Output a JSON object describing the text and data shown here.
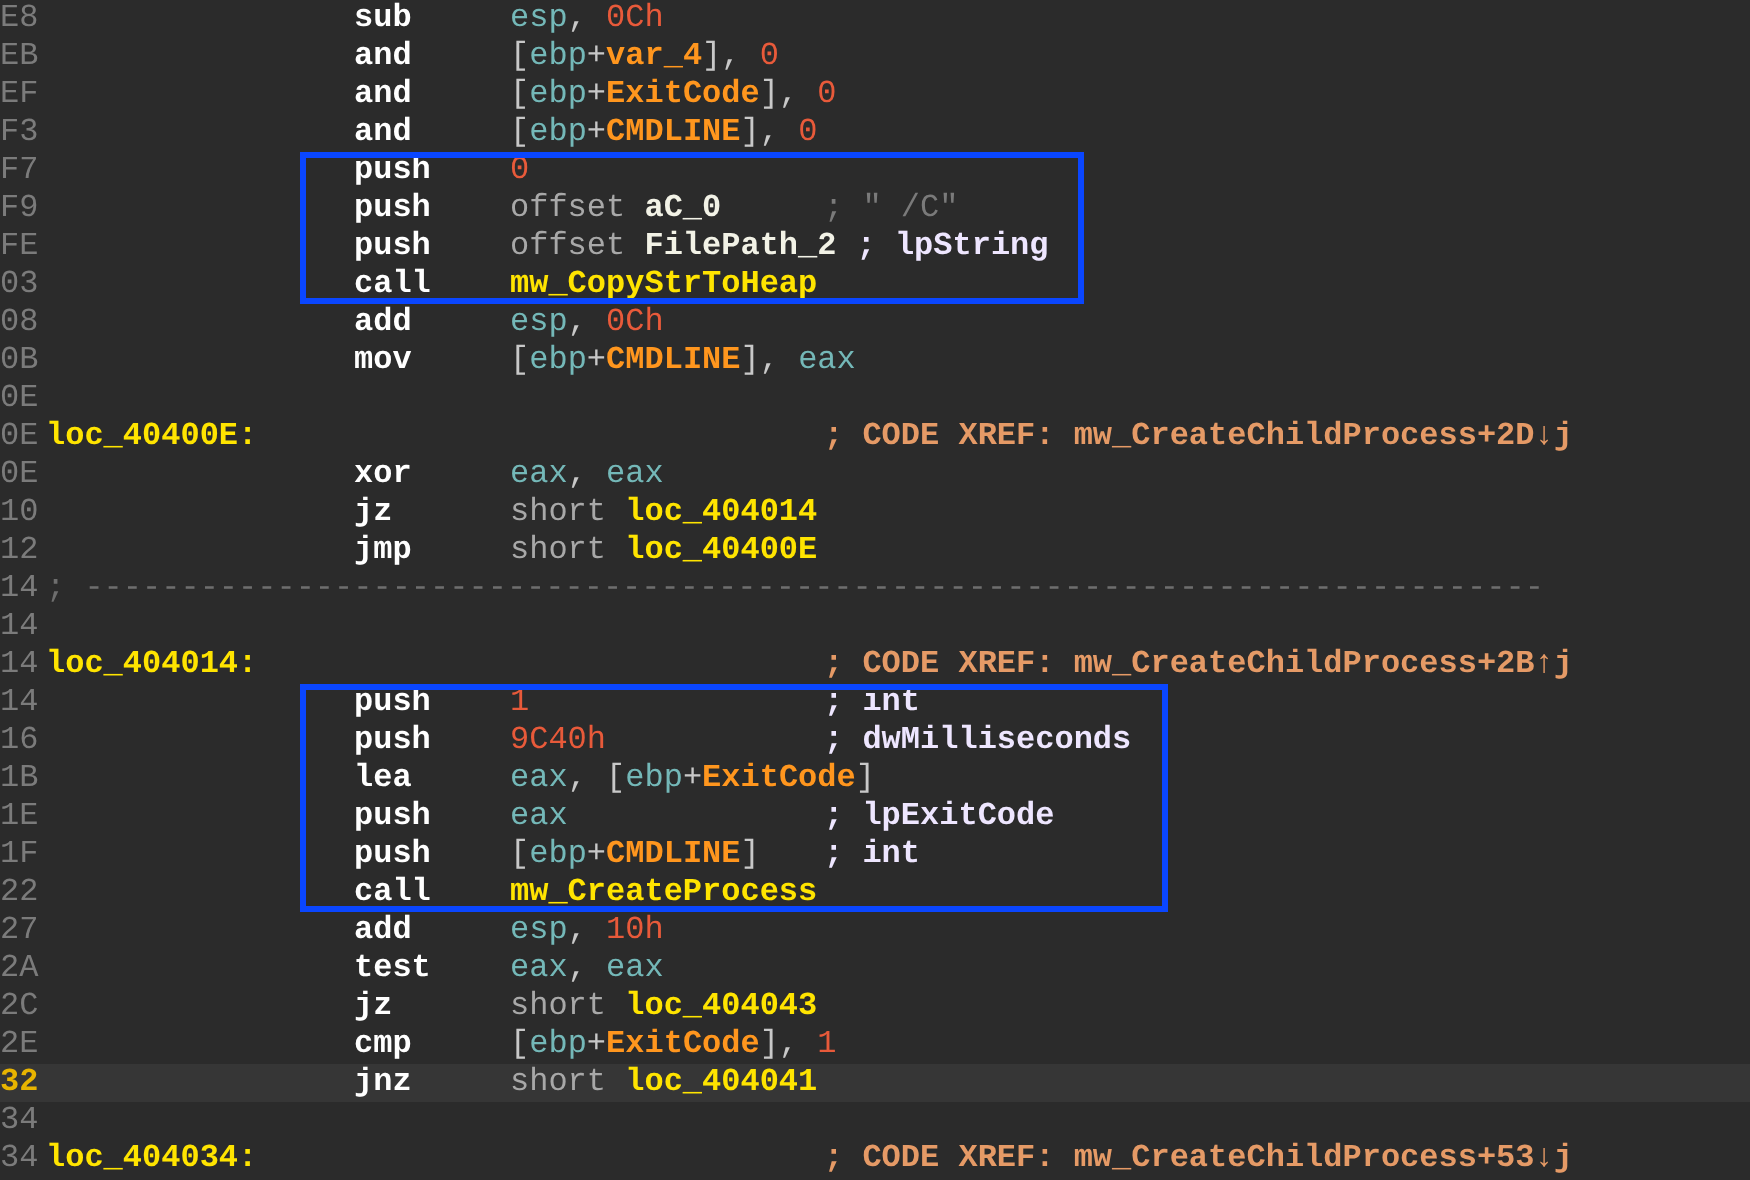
{
  "listing": [
    {
      "highlighted": false,
      "rows": [
        {
          "kind": "instr",
          "address": "E8",
          "current": false,
          "mnemonic": "sub",
          "operand": [
            {
              "text": "esp",
              "kind": "reg"
            },
            {
              "text": ", ",
              "kind": "punct"
            },
            {
              "text": "0Ch",
              "kind": "num"
            }
          ]
        },
        {
          "kind": "instr",
          "address": "EB",
          "current": false,
          "mnemonic": "and",
          "operand": [
            {
              "text": "[",
              "kind": "punct"
            },
            {
              "text": "ebp",
              "kind": "reg"
            },
            {
              "text": "+",
              "kind": "punct"
            },
            {
              "text": "var_4",
              "kind": "var"
            },
            {
              "text": "], ",
              "kind": "punct"
            },
            {
              "text": "0",
              "kind": "num"
            }
          ]
        },
        {
          "kind": "instr",
          "address": "EF",
          "current": false,
          "mnemonic": "and",
          "operand": [
            {
              "text": "[",
              "kind": "punct"
            },
            {
              "text": "ebp",
              "kind": "reg"
            },
            {
              "text": "+",
              "kind": "punct"
            },
            {
              "text": "ExitCode",
              "kind": "var"
            },
            {
              "text": "], ",
              "kind": "punct"
            },
            {
              "text": "0",
              "kind": "num"
            }
          ]
        },
        {
          "kind": "instr",
          "address": "F3",
          "current": false,
          "mnemonic": "and",
          "operand": [
            {
              "text": "[",
              "kind": "punct"
            },
            {
              "text": "ebp",
              "kind": "reg"
            },
            {
              "text": "+",
              "kind": "punct"
            },
            {
              "text": "CMDLINE",
              "kind": "var"
            },
            {
              "text": "], ",
              "kind": "punct"
            },
            {
              "text": "0",
              "kind": "num"
            }
          ]
        }
      ]
    },
    {
      "highlighted": true,
      "rows": [
        {
          "kind": "instr",
          "address": "F7",
          "current": false,
          "mnemonic": "push",
          "operand": [
            {
              "text": "0",
              "kind": "num"
            }
          ]
        },
        {
          "kind": "instr",
          "address": "F9",
          "current": false,
          "mnemonic": "push",
          "operand": [
            {
              "text": "offset ",
              "kind": "kw"
            },
            {
              "text": "aC_0",
              "kind": "name"
            }
          ],
          "comment": {
            "text": "; \" /C\"",
            "kind": "string"
          }
        },
        {
          "kind": "instr",
          "address": "FE",
          "current": false,
          "mnemonic": "push",
          "operand": [
            {
              "text": "offset ",
              "kind": "kw"
            },
            {
              "text": "FilePath_2",
              "kind": "name"
            }
          ],
          "comment": {
            "text": "; lpString",
            "kind": "arg"
          }
        },
        {
          "kind": "instr",
          "address": "03",
          "current": false,
          "mnemonic": "call",
          "operand": [
            {
              "text": "mw_CopyStrToHeap",
              "kind": "ref"
            }
          ]
        }
      ]
    },
    {
      "highlighted": false,
      "rows": [
        {
          "kind": "instr",
          "address": "08",
          "current": false,
          "mnemonic": "add",
          "operand": [
            {
              "text": "esp",
              "kind": "reg"
            },
            {
              "text": ", ",
              "kind": "punct"
            },
            {
              "text": "0Ch",
              "kind": "num"
            }
          ]
        },
        {
          "kind": "instr",
          "address": "0B",
          "current": false,
          "mnemonic": "mov",
          "operand": [
            {
              "text": "[",
              "kind": "punct"
            },
            {
              "text": "ebp",
              "kind": "reg"
            },
            {
              "text": "+",
              "kind": "punct"
            },
            {
              "text": "CMDLINE",
              "kind": "var"
            },
            {
              "text": "], ",
              "kind": "punct"
            },
            {
              "text": "eax",
              "kind": "reg"
            }
          ]
        },
        {
          "kind": "blank",
          "address": "0E",
          "current": false
        },
        {
          "kind": "label",
          "address": "0E",
          "current": false,
          "label": "loc_40400E:",
          "comment": {
            "text": "; CODE XREF: mw_CreateChildProcess+2D↓j",
            "kind": "xref"
          }
        },
        {
          "kind": "instr",
          "address": "0E",
          "current": false,
          "mnemonic": "xor",
          "operand": [
            {
              "text": "eax",
              "kind": "reg"
            },
            {
              "text": ", ",
              "kind": "punct"
            },
            {
              "text": "eax",
              "kind": "reg"
            }
          ]
        },
        {
          "kind": "instr",
          "address": "10",
          "current": false,
          "mnemonic": "jz",
          "operand": [
            {
              "text": "short ",
              "kind": "kw"
            },
            {
              "text": "loc_404014",
              "kind": "ref"
            }
          ]
        },
        {
          "kind": "instr",
          "address": "12",
          "current": false,
          "mnemonic": "jmp",
          "operand": [
            {
              "text": "short ",
              "kind": "kw"
            },
            {
              "text": "loc_40400E",
              "kind": "ref"
            }
          ]
        },
        {
          "kind": "separator",
          "address": "14",
          "current": false,
          "text": "; ----------------------------------------------------------------------------"
        },
        {
          "kind": "blank",
          "address": "14",
          "current": false
        },
        {
          "kind": "label",
          "address": "14",
          "current": false,
          "label": "loc_404014:",
          "comment": {
            "text": "; CODE XREF: mw_CreateChildProcess+2B↑j",
            "kind": "xref"
          }
        }
      ]
    },
    {
      "highlighted": true,
      "rows": [
        {
          "kind": "instr",
          "address": "14",
          "current": false,
          "mnemonic": "push",
          "operand": [
            {
              "text": "1",
              "kind": "num"
            }
          ],
          "comment": {
            "text": "; int",
            "kind": "arg"
          }
        },
        {
          "kind": "instr",
          "address": "16",
          "current": false,
          "mnemonic": "push",
          "operand": [
            {
              "text": "9C40h",
              "kind": "num"
            }
          ],
          "comment": {
            "text": "; dwMilliseconds",
            "kind": "arg"
          }
        },
        {
          "kind": "instr",
          "address": "1B",
          "current": false,
          "mnemonic": "lea",
          "operand": [
            {
              "text": "eax",
              "kind": "reg"
            },
            {
              "text": ", [",
              "kind": "punct"
            },
            {
              "text": "ebp",
              "kind": "reg"
            },
            {
              "text": "+",
              "kind": "punct"
            },
            {
              "text": "ExitCode",
              "kind": "var"
            },
            {
              "text": "]",
              "kind": "punct"
            }
          ]
        },
        {
          "kind": "instr",
          "address": "1E",
          "current": false,
          "mnemonic": "push",
          "operand": [
            {
              "text": "eax",
              "kind": "reg"
            }
          ],
          "comment": {
            "text": "; lpExitCode",
            "kind": "arg"
          }
        },
        {
          "kind": "instr",
          "address": "1F",
          "current": false,
          "mnemonic": "push",
          "operand": [
            {
              "text": "[",
              "kind": "punct"
            },
            {
              "text": "ebp",
              "kind": "reg"
            },
            {
              "text": "+",
              "kind": "punct"
            },
            {
              "text": "CMDLINE",
              "kind": "var"
            },
            {
              "text": "]",
              "kind": "punct"
            }
          ],
          "comment": {
            "text": "; int",
            "kind": "arg"
          }
        },
        {
          "kind": "instr",
          "address": "22",
          "current": false,
          "mnemonic": "call",
          "operand": [
            {
              "text": "mw_CreateProcess",
              "kind": "ref"
            }
          ]
        }
      ]
    },
    {
      "highlighted": false,
      "rows": [
        {
          "kind": "instr",
          "address": "27",
          "current": false,
          "mnemonic": "add",
          "operand": [
            {
              "text": "esp",
              "kind": "reg"
            },
            {
              "text": ", ",
              "kind": "punct"
            },
            {
              "text": "10h",
              "kind": "num"
            }
          ]
        },
        {
          "kind": "instr",
          "address": "2A",
          "current": false,
          "mnemonic": "test",
          "operand": [
            {
              "text": "eax",
              "kind": "reg"
            },
            {
              "text": ", ",
              "kind": "punct"
            },
            {
              "text": "eax",
              "kind": "reg"
            }
          ]
        },
        {
          "kind": "instr",
          "address": "2C",
          "current": false,
          "mnemonic": "jz",
          "operand": [
            {
              "text": "short ",
              "kind": "kw"
            },
            {
              "text": "loc_404043",
              "kind": "ref"
            }
          ]
        },
        {
          "kind": "instr",
          "address": "2E",
          "current": false,
          "mnemonic": "cmp",
          "operand": [
            {
              "text": "[",
              "kind": "punct"
            },
            {
              "text": "ebp",
              "kind": "reg"
            },
            {
              "text": "+",
              "kind": "punct"
            },
            {
              "text": "ExitCode",
              "kind": "var"
            },
            {
              "text": "], ",
              "kind": "punct"
            },
            {
              "text": "1",
              "kind": "num"
            }
          ]
        },
        {
          "kind": "instr",
          "address": "32",
          "current": true,
          "mnemonic": "jnz",
          "operand": [
            {
              "text": "short ",
              "kind": "kw"
            },
            {
              "text": "loc_404041",
              "kind": "ref"
            }
          ]
        },
        {
          "kind": "blank",
          "address": "34",
          "current": false
        },
        {
          "kind": "label",
          "address": "34",
          "current": false,
          "label": "loc_404034:",
          "comment": {
            "text": "; CODE XREF: mw_CreateChildProcess+53↓j",
            "kind": "xref"
          }
        }
      ]
    }
  ]
}
